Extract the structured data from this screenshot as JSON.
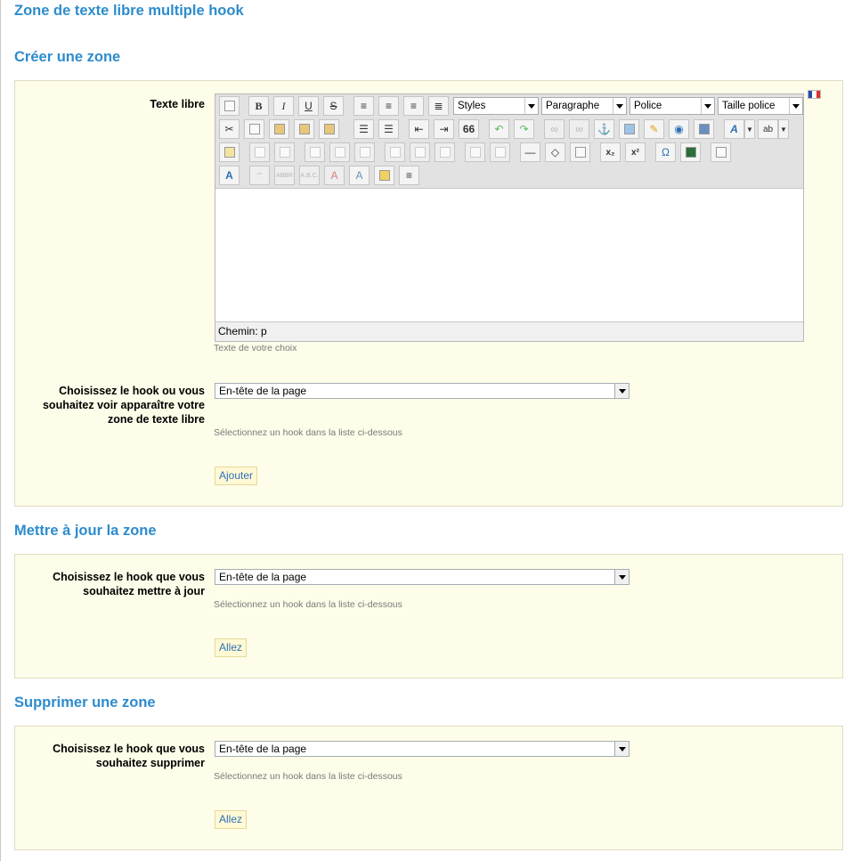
{
  "page": {
    "title": "Zone de texte libre multiple hook"
  },
  "create": {
    "title": "Créer une zone",
    "text_label": "Texte libre",
    "editor": {
      "styles": "Styles",
      "format": "Paragraphe",
      "font": "Police",
      "size": "Taille police",
      "status": "Chemin: p",
      "bold": "B",
      "italic": "I",
      "underline": "U",
      "strike": "S",
      "quote": "66",
      "subscript": "x₂",
      "superscript": "x²",
      "omega": "Ω",
      "textcolor": "A",
      "highlight": "ab"
    },
    "text_hint": "Texte de votre choix",
    "hook_label": "Choisissez le hook ou vous souhaitez voir apparaître votre zone de texte libre",
    "hook_value": "En-tête de la page",
    "hook_hint": "Sélectionnez un hook dans la liste ci-dessous",
    "button": "Ajouter"
  },
  "update": {
    "title": "Mettre à jour la zone",
    "hook_label": "Choisissez le hook que vous souhaitez mettre à jour",
    "hook_value": "En-tête de la page",
    "hook_hint": "Sélectionnez un hook dans la liste ci-dessous",
    "button": "Allez"
  },
  "delete": {
    "title": "Supprimer une zone",
    "hook_label": "Choisissez le hook que vous souhaitez supprimer",
    "hook_value": "En-tête de la page",
    "hook_hint": "Sélectionnez un hook dans la liste ci-dessous",
    "button": "Allez"
  },
  "colors": {
    "accent": "#2d8ccd",
    "panel_bg": "#fdfde9",
    "button_text": "#2d6fb5"
  },
  "icons": [
    "new-document-icon",
    "cut-icon",
    "copy-icon",
    "paste-icon",
    "undo-icon",
    "redo-icon",
    "link-icon",
    "anchor-icon",
    "image-icon",
    "help-icon",
    "table-icon",
    "flag-fr-icon"
  ]
}
